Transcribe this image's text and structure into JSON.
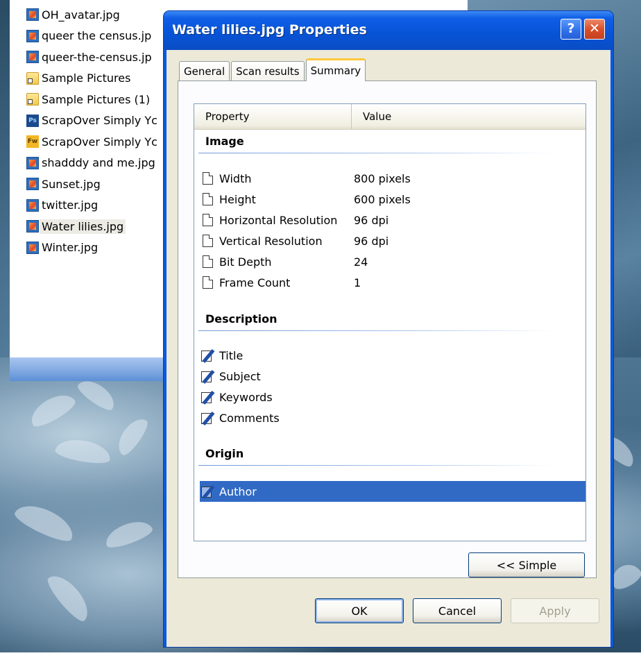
{
  "explorer": {
    "files": [
      {
        "name": "OH_avatar.jpg",
        "icon": "jpg-file-icon"
      },
      {
        "name": "queer the census.jp",
        "icon": "jpg-file-icon"
      },
      {
        "name": "queer-the-census.jp",
        "icon": "jpg-file-icon"
      },
      {
        "name": "Sample Pictures",
        "icon": "folder-shortcut-icon"
      },
      {
        "name": "Sample Pictures (1)",
        "icon": "folder-shortcut-icon"
      },
      {
        "name": "ScrapOver Simply Yc",
        "icon": "photoshop-file-icon"
      },
      {
        "name": "ScrapOver Simply Yc",
        "icon": "fireworks-file-icon"
      },
      {
        "name": "shadddy and me.jpg",
        "icon": "jpg-file-icon"
      },
      {
        "name": "Sunset.jpg",
        "icon": "jpg-file-icon"
      },
      {
        "name": "twitter.jpg",
        "icon": "jpg-file-icon"
      },
      {
        "name": "Water lilies.jpg",
        "icon": "jpg-file-icon"
      },
      {
        "name": "Winter.jpg",
        "icon": "jpg-file-icon"
      }
    ],
    "selected_file": "Water lilies.jpg",
    "ps_badge": "Ps",
    "fw_badge": "Fw"
  },
  "dialog": {
    "title": "Water lilies.jpg Properties",
    "help_label": "?",
    "close_label": "✕",
    "tabs": [
      {
        "label": "General",
        "active": false
      },
      {
        "label": "Scan results",
        "active": false
      },
      {
        "label": "Summary",
        "active": true
      }
    ],
    "list": {
      "columns": {
        "property": "Property",
        "value": "Value"
      },
      "groups": {
        "image": {
          "title": "Image",
          "rows": [
            {
              "name": "Width",
              "value": "800 pixels"
            },
            {
              "name": "Height",
              "value": "600 pixels"
            },
            {
              "name": "Horizontal Resolution",
              "value": "96 dpi"
            },
            {
              "name": "Vertical Resolution",
              "value": "96 dpi"
            },
            {
              "name": "Bit Depth",
              "value": "24"
            },
            {
              "name": "Frame Count",
              "value": "1"
            }
          ]
        },
        "description": {
          "title": "Description",
          "rows": [
            {
              "name": "Title",
              "value": ""
            },
            {
              "name": "Subject",
              "value": ""
            },
            {
              "name": "Keywords",
              "value": ""
            },
            {
              "name": "Comments",
              "value": ""
            }
          ]
        },
        "origin": {
          "title": "Origin",
          "rows": [
            {
              "name": "Author",
              "value": ""
            }
          ]
        }
      }
    },
    "simple_button": "<< Simple",
    "ok_button": "OK",
    "cancel_button": "Cancel",
    "apply_button": "Apply",
    "selection_color": "#316ac5",
    "titlebar_color": "#0a5ae0"
  }
}
